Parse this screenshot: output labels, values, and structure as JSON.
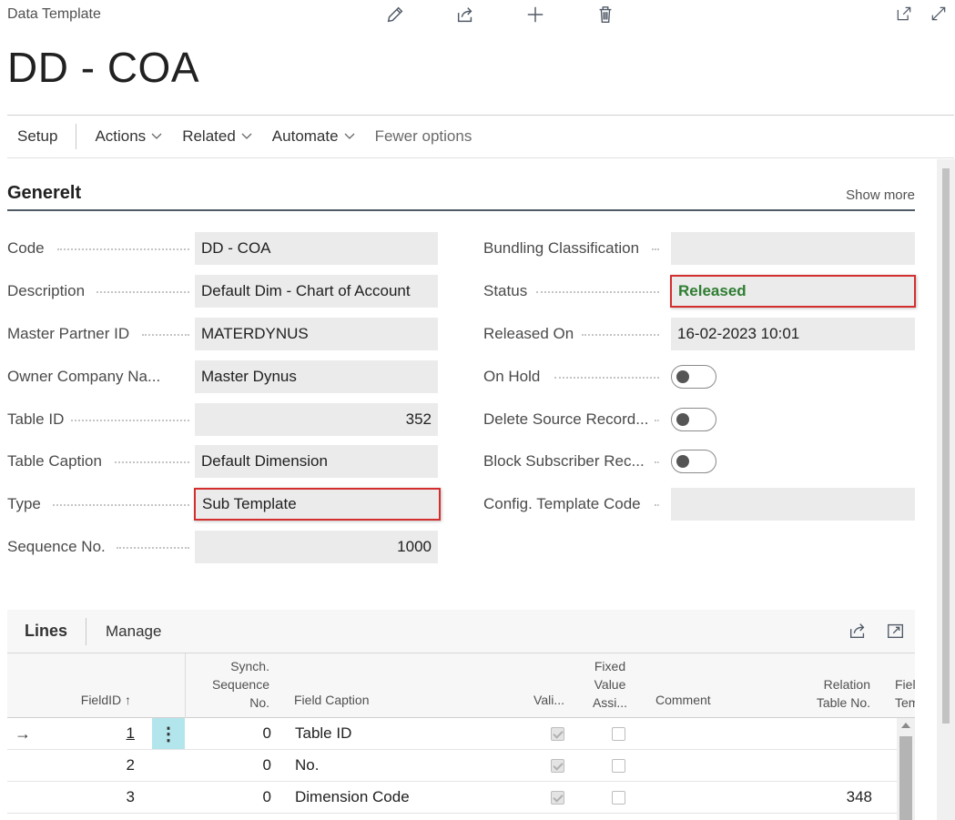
{
  "header": {
    "caption": "Data Template",
    "title": "DD - COA"
  },
  "toolbar": {
    "icons": [
      "edit-icon",
      "share-icon",
      "new-icon",
      "delete-icon"
    ],
    "right_icons": [
      "open-new-window-icon",
      "expand-icon"
    ]
  },
  "actions": {
    "setup": "Setup",
    "actions": "Actions",
    "related": "Related",
    "automate": "Automate",
    "fewer": "Fewer options"
  },
  "general": {
    "title": "Generelt",
    "show_more": "Show more",
    "left": [
      {
        "label": "Code",
        "value": "DD - COA"
      },
      {
        "label": "Description",
        "value": "Default Dim - Chart of Account"
      },
      {
        "label": "Master Partner ID",
        "value": "MATERDYNUS"
      },
      {
        "label": "Owner Company Na...",
        "value": "Master Dynus"
      },
      {
        "label": "Table ID",
        "value": "352"
      },
      {
        "label": "Table Caption",
        "value": "Default Dimension"
      },
      {
        "label": "Type",
        "value": "Sub Template"
      },
      {
        "label": "Sequence No.",
        "value": "1000"
      }
    ],
    "right": [
      {
        "label": "Bundling Classification",
        "value": ""
      },
      {
        "label": "Status",
        "value": "Released"
      },
      {
        "label": "Released On",
        "value": "16-02-2023 10:01"
      },
      {
        "label": "On Hold",
        "value": false
      },
      {
        "label": "Delete Source Record...",
        "value": false
      },
      {
        "label": "Block Subscriber Rec...",
        "value": false
      },
      {
        "label": "Config. Template Code",
        "value": ""
      }
    ],
    "status_color": "#2e7d32",
    "highlight_color": "#d32f2f"
  },
  "lines": {
    "title": "Lines",
    "manage": "Manage",
    "columns": {
      "field_id": "FieldID ↑",
      "synch_l1": "Synch.",
      "synch_l2": "Sequence",
      "synch_l3": "No.",
      "caption": "Field Caption",
      "vali": "Vali...",
      "fixed_l1": "Fixed",
      "fixed_l2": "Value",
      "fixed_l3": "Assi...",
      "comment": "Comment",
      "rel_l1": "Relation",
      "rel_l2": "Table No.",
      "fiel_l1": "Fiel",
      "fiel_l2": "Tem"
    },
    "rows": [
      {
        "field_id": "1",
        "synch": "0",
        "caption": "Table ID",
        "vali": true,
        "fixed": false,
        "comment": "",
        "relation": ""
      },
      {
        "field_id": "2",
        "synch": "0",
        "caption": "No.",
        "vali": true,
        "fixed": false,
        "comment": "",
        "relation": ""
      },
      {
        "field_id": "3",
        "synch": "0",
        "caption": "Dimension Code",
        "vali": true,
        "fixed": false,
        "comment": "",
        "relation": "348"
      }
    ]
  }
}
